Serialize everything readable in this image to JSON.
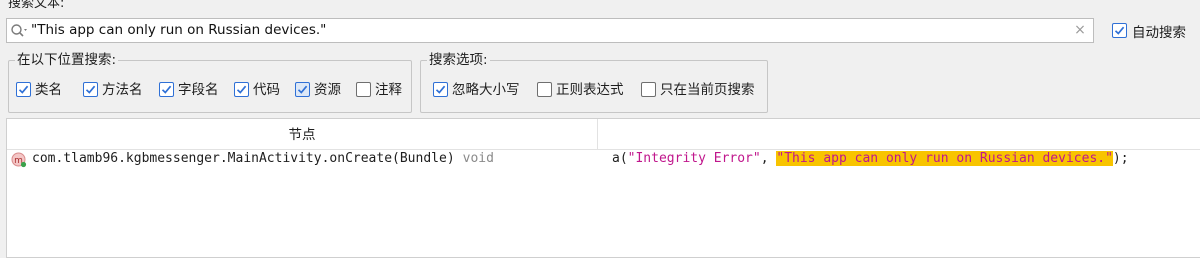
{
  "search": {
    "label": "搜索文本:",
    "value": "\"This app can only run on Russian devices.\"",
    "auto_search_label": "自动搜索",
    "auto_search_checked": true
  },
  "location_group": {
    "title": "在以下位置搜索:",
    "options": [
      {
        "label": "类名",
        "checked": true
      },
      {
        "label": "方法名",
        "checked": true
      },
      {
        "label": "字段名",
        "checked": true
      },
      {
        "label": "代码",
        "checked": true
      },
      {
        "label": "资源",
        "checked": true
      },
      {
        "label": "注释",
        "checked": false
      }
    ]
  },
  "search_options_group": {
    "title": "搜索选项:",
    "options": [
      {
        "label": "忽略大小写",
        "checked": true
      },
      {
        "label": "正则表达式",
        "checked": false
      },
      {
        "label": "只在当前页搜索",
        "checked": false
      }
    ]
  },
  "results": {
    "columns": {
      "node": "节点",
      "code": ""
    },
    "rows": [
      {
        "node": "com.tlamb96.kgbmessenger.MainActivity.onCreate(Bundle)",
        "return_type": "void",
        "code_prefix": "a(",
        "code_str1": "\"Integrity Error\"",
        "code_sep": ", ",
        "code_match": "\"This app can only run on Russian devices.\"",
        "code_suffix": ");"
      }
    ]
  },
  "colors": {
    "highlight": "#f8c400",
    "string": "#c0168c",
    "checkbox_accent": "#2f70d6"
  }
}
